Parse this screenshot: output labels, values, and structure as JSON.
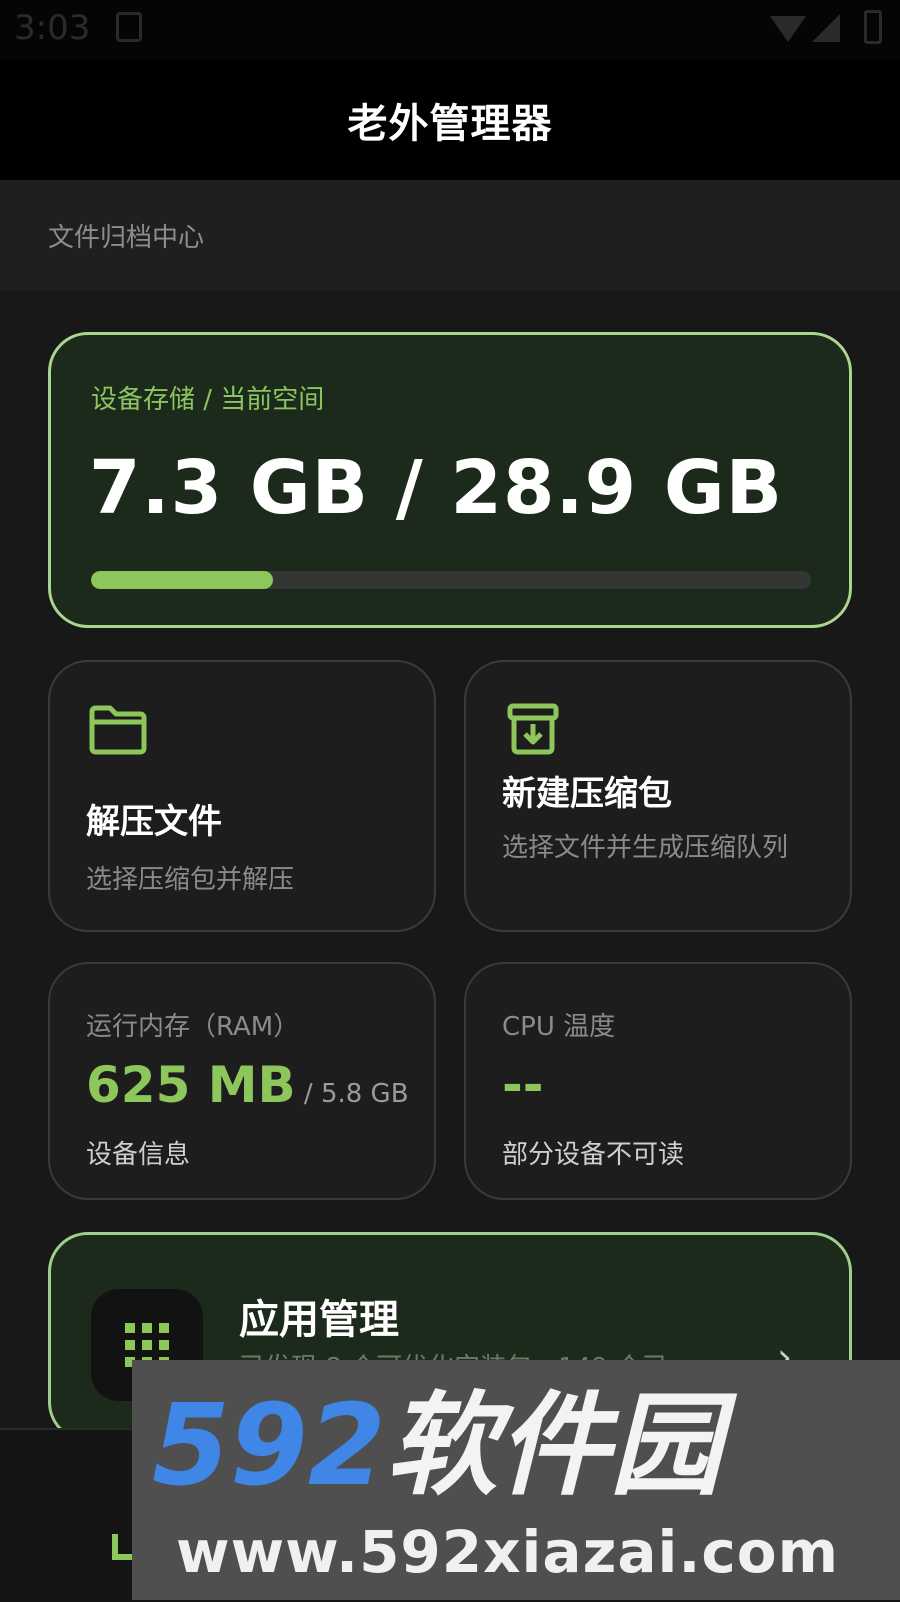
{
  "status_bar": {
    "time": "3:03"
  },
  "app_bar": {
    "title": "老外管理器"
  },
  "sub_header": {
    "text": "文件归档中心"
  },
  "storage": {
    "label": "设备存储 / 当前空间",
    "value": "7.3 GB / 28.9 GB",
    "used_fraction": 0.253,
    "bar_color": "#8dc65a",
    "border_color": "#a9d58f"
  },
  "extract_card": {
    "title": "解压文件",
    "desc": "选择压缩包并解压",
    "icon": "folder-icon"
  },
  "new_archive_card": {
    "title": "新建压缩包",
    "desc": "选择文件并生成压缩队列",
    "icon": "archive-icon"
  },
  "ram_card": {
    "label": "运行内存（RAM）",
    "value": "625 MB",
    "total": " / 5.8 GB",
    "foot": "设备信息"
  },
  "cpu_card": {
    "label": "CPU 温度",
    "value": "--",
    "foot": "部分设备不可读"
  },
  "app_management": {
    "title": "应用管理",
    "desc": "已发现 8 个可优化安装包，149 个已",
    "icon": "grid-icon"
  },
  "watermark": {
    "brand_num": "592",
    "brand_cn": "软件园",
    "url": "www.592xiazai.com"
  },
  "colors": {
    "accent": "#8dc65a",
    "background": "#181818",
    "card": "#1d1d1d"
  }
}
